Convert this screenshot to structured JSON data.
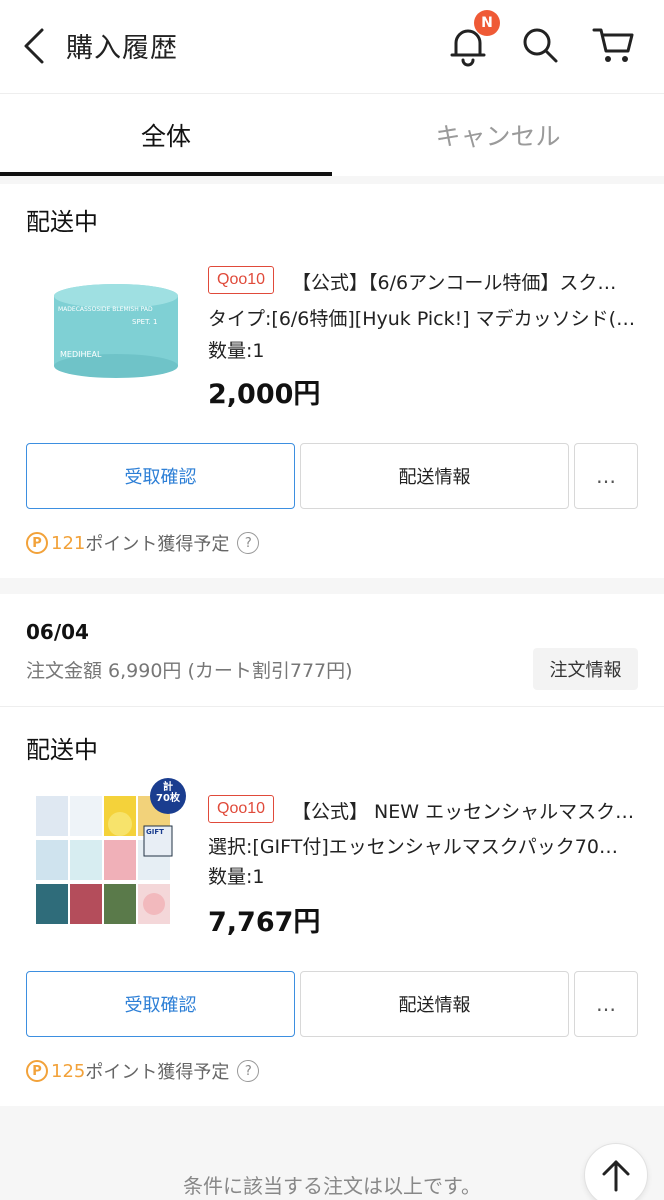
{
  "header": {
    "title": "購入履歴",
    "notification_badge": "N"
  },
  "tabs": [
    {
      "label": "全体"
    },
    {
      "label": "キャンセル"
    }
  ],
  "orders": [
    {
      "status": "配送中",
      "shop_badge": "Qoo10",
      "title": "【公式】【6/6アンコール特価】スク…",
      "option": "タイプ:[6/6特価][Hyuk Pick!] マデカッソシド(-5…",
      "quantity": "数量:1",
      "price": "2,000円",
      "confirm_label": "受取確認",
      "shipping_label": "配送情報",
      "more_label": "…",
      "points_icon": "P",
      "points_value": "121",
      "points_text": "ポイント獲得予定",
      "help_icon": "?",
      "product_label": "MEDIHEAL",
      "product_sublabel": "MADECASSOSIDE BLEMISH PAD",
      "product_step": "SPET. 1"
    },
    {
      "date": "06/04",
      "total_text": "注文金額 6,990円 (カート割引777円)",
      "order_info_label": "注文情報",
      "status": "配送中",
      "shop_badge": "Qoo10",
      "title": "【公式】 NEW エッセンシャルマスク…",
      "option": "選択:[GIFT付]エッセンシャルマスクパック70…",
      "quantity": "数量:1",
      "price": "7,767円",
      "confirm_label": "受取確認",
      "shipping_label": "配送情報",
      "more_label": "…",
      "points_icon": "P",
      "points_value": "125",
      "points_text": "ポイント獲得予定",
      "help_icon": "?",
      "bundle_badge_line1": "計",
      "bundle_badge_line2": "70枚",
      "gift_label": "GIFT"
    }
  ],
  "footer": {
    "message": "条件に該当する注文は以上です。"
  },
  "colors": {
    "accent_red": "#e04a3a",
    "confirm_blue": "#2d7fd6",
    "points_orange": "#f2a23a"
  }
}
